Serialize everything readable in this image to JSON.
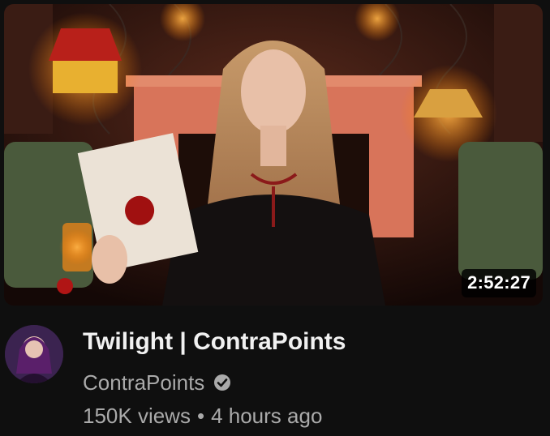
{
  "video": {
    "title": "Twilight | ContraPoints",
    "duration": "2:52:27",
    "channel": "ContraPoints",
    "views": "150K views",
    "separator": "•",
    "age": "4 hours ago"
  },
  "icons": {
    "verified": "verified-check-icon",
    "avatar": "channel-avatar"
  },
  "colors": {
    "background": "#0f0f0f",
    "title": "#f1f1f1",
    "secondary_text": "#aaaaaa",
    "duration_bg": "#000000"
  }
}
